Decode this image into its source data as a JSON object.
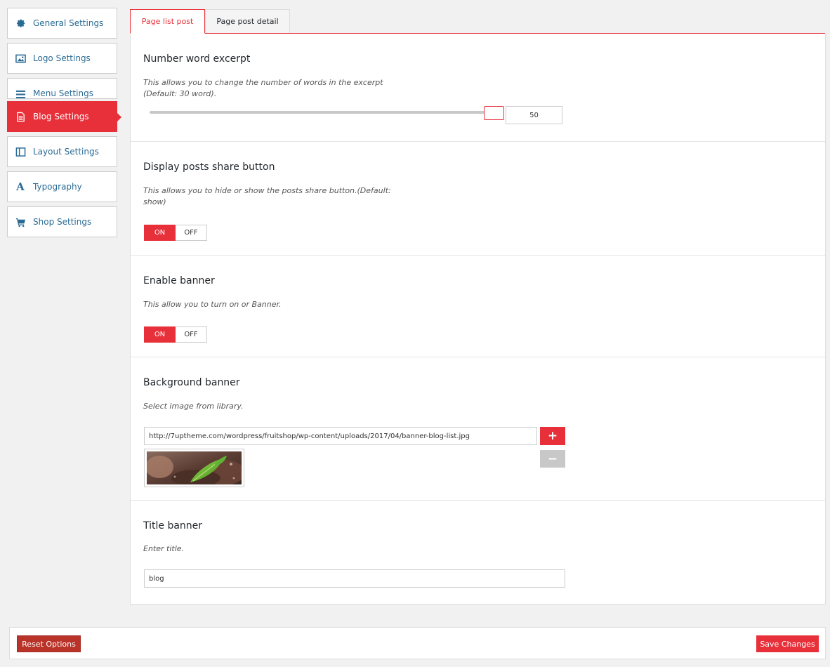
{
  "sidebar": {
    "items": [
      {
        "label": "General Settings",
        "icon": "gear-icon"
      },
      {
        "label": "Logo Settings",
        "icon": "image-icon"
      },
      {
        "label": "Menu Settings",
        "icon": "menu-icon"
      },
      {
        "label": "Blog Settings",
        "icon": "document-icon",
        "active": true
      },
      {
        "label": "Layout Settings",
        "icon": "layout-icon"
      },
      {
        "label": "Typography",
        "icon": "font-icon"
      },
      {
        "label": "Shop Settings",
        "icon": "cart-icon"
      }
    ]
  },
  "tabs": [
    {
      "label": "Page list post",
      "active": true
    },
    {
      "label": "Page post detail",
      "active": false
    }
  ],
  "sections": {
    "excerpt": {
      "title": "Number word excerpt",
      "desc_line1": "This allows you to change the number of words in the excerpt",
      "desc_line2": "(Default: 30 word).",
      "value": "50"
    },
    "share": {
      "title": "Display posts share button",
      "desc_line1": "This allows you to hide or show the posts share button.(Default:",
      "desc_line2": "show)",
      "on_label": "ON",
      "off_label": "OFF",
      "state": "on"
    },
    "banner": {
      "title": "Enable banner",
      "desc": "This allow you to turn on or Banner.",
      "on_label": "ON",
      "off_label": "OFF",
      "state": "on"
    },
    "bg_banner": {
      "title": "Background banner",
      "desc": "Select image from library.",
      "url": "http://7uptheme.com/wordpress/fruitshop/wp-content/uploads/2017/04/banner-blog-list.jpg",
      "add_label": "+",
      "remove_label": "−"
    },
    "title_banner": {
      "title": "Title banner",
      "desc": "Enter title.",
      "value": "blog"
    }
  },
  "footer": {
    "reset_label": "Reset Options",
    "save_label": "Save Changes"
  },
  "colors": {
    "accent": "#e8303a",
    "link": "#2a6b94",
    "reset": "#b93329"
  }
}
